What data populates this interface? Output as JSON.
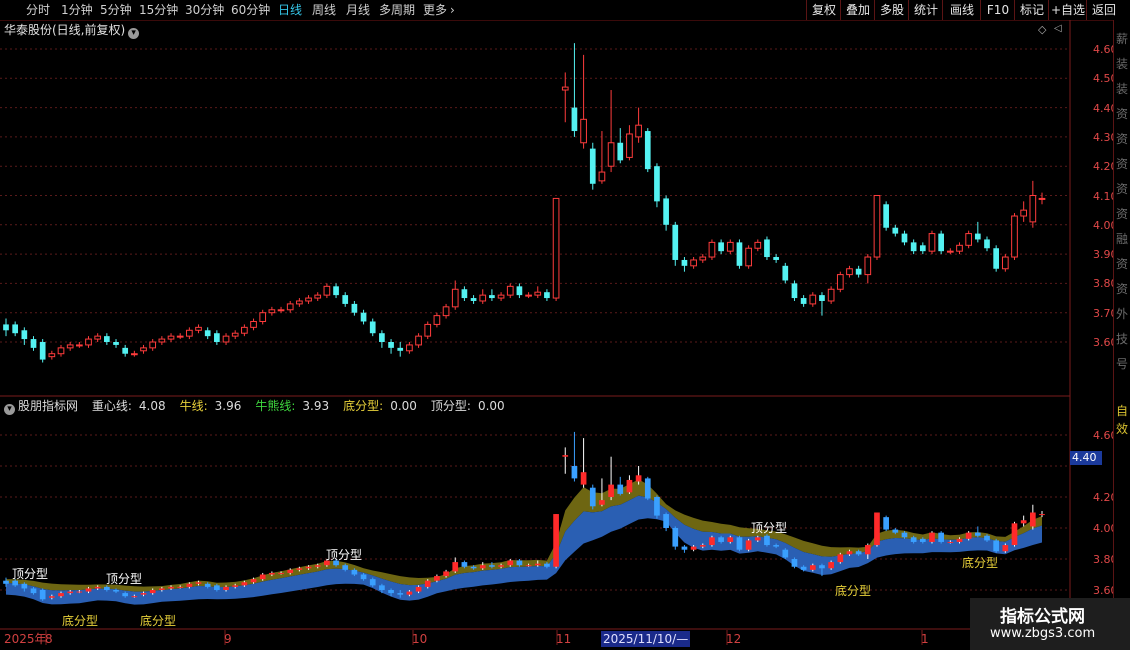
{
  "toolbar": {
    "periods": [
      "分时",
      "1分钟",
      "5分钟",
      "15分钟",
      "30分钟",
      "60分钟",
      "日线",
      "周线",
      "月线",
      "多周期",
      "更多"
    ],
    "active_period": "日线",
    "more_arrow": "›",
    "right_buttons": [
      "复权",
      "叠加",
      "多股",
      "统计",
      "画线",
      "F10",
      "标记",
      "+自选",
      "返回"
    ]
  },
  "main_chart": {
    "title": "华泰股份(日线,前复权)",
    "dropdown_icon": "chevron-down-icon",
    "price_axis": [
      "4.60",
      "4.50",
      "4.40",
      "4.30",
      "4.20",
      "4.10",
      "4.00",
      "3.90",
      "3.80",
      "3.70",
      "3.60"
    ]
  },
  "indicator": {
    "name": "股朋指标网",
    "fields": [
      {
        "label": "重心线:",
        "value": "4.08",
        "color": "#dcdcdc"
      },
      {
        "label": "牛线:",
        "value": "3.96",
        "color": "#e8d13a"
      },
      {
        "label": "牛熊线:",
        "value": "3.93",
        "color": "#3ed63e"
      },
      {
        "label": "底分型:",
        "value": "0.00",
        "color": "#e8d13a"
      },
      {
        "label": "顶分型:",
        "value": "0.00",
        "color": "#dcdcdc"
      }
    ],
    "price_axis": [
      "4.60",
      "4.40",
      "4.20",
      "4.00",
      "3.80",
      "3.60"
    ],
    "current_price": "4.40",
    "annotations": {
      "top": [
        "顶分型",
        "顶分型",
        "顶分型",
        "顶分型"
      ],
      "bottom": [
        "底分型",
        "底分型",
        "底分型",
        "底分型"
      ]
    }
  },
  "date_axis": {
    "labels": [
      "2025年",
      "8",
      "9",
      "10",
      "11",
      "2025/11/10/—",
      "12",
      "1"
    ]
  },
  "sidebar_chars": [
    "薪",
    "装",
    "装",
    "资",
    "资",
    "资",
    "资",
    "资",
    "融",
    "资",
    "资",
    "外",
    "技",
    "号"
  ],
  "sidebar_chars2": [
    "自",
    "效"
  ],
  "watermark": {
    "line1": "指标公式网",
    "line2": "www.zbgs3.com"
  },
  "colors": {
    "up": "#ff3c3c",
    "down": "#54f2f2",
    "gold": "#6e6612",
    "blue": "#2a5fb3",
    "axis": "#e04848"
  },
  "chart_data": {
    "type": "candlestick",
    "title": "华泰股份(日线,前复权)",
    "y_range": [
      3.52,
      4.65
    ],
    "x_labels": [
      "2025年",
      "8",
      "9",
      "10",
      "11",
      "12",
      "1"
    ],
    "candles": [
      {
        "o": 3.66,
        "c": 3.64,
        "h": 3.68,
        "l": 3.62
      },
      {
        "o": 3.66,
        "c": 3.63,
        "h": 3.67,
        "l": 3.62
      },
      {
        "o": 3.64,
        "c": 3.61,
        "h": 3.65,
        "l": 3.59
      },
      {
        "o": 3.61,
        "c": 3.58,
        "h": 3.62,
        "l": 3.57
      },
      {
        "o": 3.6,
        "c": 3.54,
        "h": 3.61,
        "l": 3.53
      },
      {
        "o": 3.55,
        "c": 3.56,
        "h": 3.57,
        "l": 3.54
      },
      {
        "o": 3.56,
        "c": 3.58,
        "h": 3.59,
        "l": 3.55
      },
      {
        "o": 3.58,
        "c": 3.59,
        "h": 3.6,
        "l": 3.57
      },
      {
        "o": 3.59,
        "c": 3.59,
        "h": 3.6,
        "l": 3.58
      },
      {
        "o": 3.59,
        "c": 3.61,
        "h": 3.62,
        "l": 3.58
      },
      {
        "o": 3.61,
        "c": 3.62,
        "h": 3.63,
        "l": 3.6
      },
      {
        "o": 3.62,
        "c": 3.6,
        "h": 3.63,
        "l": 3.59
      },
      {
        "o": 3.6,
        "c": 3.59,
        "h": 3.61,
        "l": 3.58
      },
      {
        "o": 3.58,
        "c": 3.56,
        "h": 3.59,
        "l": 3.55
      },
      {
        "o": 3.56,
        "c": 3.56,
        "h": 3.57,
        "l": 3.55
      },
      {
        "o": 3.57,
        "c": 3.58,
        "h": 3.59,
        "l": 3.56
      },
      {
        "o": 3.58,
        "c": 3.6,
        "h": 3.61,
        "l": 3.57
      },
      {
        "o": 3.6,
        "c": 3.61,
        "h": 3.62,
        "l": 3.59
      },
      {
        "o": 3.61,
        "c": 3.62,
        "h": 3.63,
        "l": 3.6
      },
      {
        "o": 3.62,
        "c": 3.62,
        "h": 3.63,
        "l": 3.61
      },
      {
        "o": 3.62,
        "c": 3.64,
        "h": 3.65,
        "l": 3.61
      },
      {
        "o": 3.64,
        "c": 3.65,
        "h": 3.66,
        "l": 3.63
      },
      {
        "o": 3.64,
        "c": 3.62,
        "h": 3.65,
        "l": 3.61
      },
      {
        "o": 3.63,
        "c": 3.6,
        "h": 3.64,
        "l": 3.59
      },
      {
        "o": 3.6,
        "c": 3.62,
        "h": 3.63,
        "l": 3.59
      },
      {
        "o": 3.62,
        "c": 3.63,
        "h": 3.64,
        "l": 3.61
      },
      {
        "o": 3.63,
        "c": 3.65,
        "h": 3.66,
        "l": 3.62
      },
      {
        "o": 3.65,
        "c": 3.67,
        "h": 3.68,
        "l": 3.64
      },
      {
        "o": 3.67,
        "c": 3.7,
        "h": 3.71,
        "l": 3.66
      },
      {
        "o": 3.7,
        "c": 3.71,
        "h": 3.72,
        "l": 3.69
      },
      {
        "o": 3.71,
        "c": 3.71,
        "h": 3.72,
        "l": 3.7
      },
      {
        "o": 3.71,
        "c": 3.73,
        "h": 3.74,
        "l": 3.7
      },
      {
        "o": 3.73,
        "c": 3.74,
        "h": 3.75,
        "l": 3.72
      },
      {
        "o": 3.74,
        "c": 3.75,
        "h": 3.76,
        "l": 3.73
      },
      {
        "o": 3.75,
        "c": 3.76,
        "h": 3.77,
        "l": 3.74
      },
      {
        "o": 3.76,
        "c": 3.79,
        "h": 3.8,
        "l": 3.75
      },
      {
        "o": 3.79,
        "c": 3.76,
        "h": 3.8,
        "l": 3.75
      },
      {
        "o": 3.76,
        "c": 3.73,
        "h": 3.77,
        "l": 3.72
      },
      {
        "o": 3.73,
        "c": 3.7,
        "h": 3.74,
        "l": 3.69
      },
      {
        "o": 3.7,
        "c": 3.67,
        "h": 3.71,
        "l": 3.66
      },
      {
        "o": 3.67,
        "c": 3.63,
        "h": 3.68,
        "l": 3.62
      },
      {
        "o": 3.63,
        "c": 3.6,
        "h": 3.64,
        "l": 3.58
      },
      {
        "o": 3.6,
        "c": 3.58,
        "h": 3.61,
        "l": 3.56
      },
      {
        "o": 3.58,
        "c": 3.57,
        "h": 3.6,
        "l": 3.55
      },
      {
        "o": 3.57,
        "c": 3.59,
        "h": 3.6,
        "l": 3.56
      },
      {
        "o": 3.59,
        "c": 3.62,
        "h": 3.63,
        "l": 3.58
      },
      {
        "o": 3.62,
        "c": 3.66,
        "h": 3.67,
        "l": 3.61
      },
      {
        "o": 3.66,
        "c": 3.69,
        "h": 3.7,
        "l": 3.65
      },
      {
        "o": 3.69,
        "c": 3.72,
        "h": 3.73,
        "l": 3.68
      },
      {
        "o": 3.72,
        "c": 3.78,
        "h": 3.81,
        "l": 3.71
      },
      {
        "o": 3.78,
        "c": 3.75,
        "h": 3.79,
        "l": 3.74
      },
      {
        "o": 3.75,
        "c": 3.74,
        "h": 3.76,
        "l": 3.73
      },
      {
        "o": 3.74,
        "c": 3.76,
        "h": 3.78,
        "l": 3.73
      },
      {
        "o": 3.76,
        "c": 3.75,
        "h": 3.78,
        "l": 3.74
      },
      {
        "o": 3.75,
        "c": 3.76,
        "h": 3.77,
        "l": 3.74
      },
      {
        "o": 3.76,
        "c": 3.79,
        "h": 3.8,
        "l": 3.75
      },
      {
        "o": 3.79,
        "c": 3.76,
        "h": 3.8,
        "l": 3.75
      },
      {
        "o": 3.76,
        "c": 3.76,
        "h": 3.77,
        "l": 3.75
      },
      {
        "o": 3.76,
        "c": 3.77,
        "h": 3.79,
        "l": 3.75
      },
      {
        "o": 3.77,
        "c": 3.75,
        "h": 3.78,
        "l": 3.74
      },
      {
        "o": 3.75,
        "c": 4.09,
        "h": 4.09,
        "l": 3.74
      },
      {
        "o": 4.46,
        "c": 4.47,
        "h": 4.52,
        "l": 4.35
      },
      {
        "o": 4.4,
        "c": 4.32,
        "h": 4.62,
        "l": 4.3
      },
      {
        "o": 4.28,
        "c": 4.36,
        "h": 4.58,
        "l": 4.26
      },
      {
        "o": 4.26,
        "c": 4.14,
        "h": 4.28,
        "l": 4.12
      },
      {
        "o": 4.15,
        "c": 4.18,
        "h": 4.32,
        "l": 4.14
      },
      {
        "o": 4.2,
        "c": 4.28,
        "h": 4.46,
        "l": 4.18
      },
      {
        "o": 4.28,
        "c": 4.22,
        "h": 4.33,
        "l": 4.21
      },
      {
        "o": 4.23,
        "c": 4.31,
        "h": 4.34,
        "l": 4.22
      },
      {
        "o": 4.3,
        "c": 4.34,
        "h": 4.4,
        "l": 4.28
      },
      {
        "o": 4.32,
        "c": 4.19,
        "h": 4.33,
        "l": 4.18
      },
      {
        "o": 4.2,
        "c": 4.08,
        "h": 4.21,
        "l": 4.06
      },
      {
        "o": 4.09,
        "c": 4.0,
        "h": 4.1,
        "l": 3.98
      },
      {
        "o": 4.0,
        "c": 3.88,
        "h": 4.01,
        "l": 3.86
      },
      {
        "o": 3.88,
        "c": 3.86,
        "h": 3.89,
        "l": 3.84
      },
      {
        "o": 3.86,
        "c": 3.88,
        "h": 3.89,
        "l": 3.85
      },
      {
        "o": 3.88,
        "c": 3.89,
        "h": 3.9,
        "l": 3.87
      },
      {
        "o": 3.89,
        "c": 3.94,
        "h": 3.95,
        "l": 3.88
      },
      {
        "o": 3.94,
        "c": 3.91,
        "h": 3.95,
        "l": 3.9
      },
      {
        "o": 3.91,
        "c": 3.94,
        "h": 3.95,
        "l": 3.9
      },
      {
        "o": 3.94,
        "c": 3.86,
        "h": 3.95,
        "l": 3.85
      },
      {
        "o": 3.86,
        "c": 3.92,
        "h": 3.93,
        "l": 3.85
      },
      {
        "o": 3.92,
        "c": 3.94,
        "h": 3.95,
        "l": 3.91
      },
      {
        "o": 3.95,
        "c": 3.89,
        "h": 3.96,
        "l": 3.88
      },
      {
        "o": 3.89,
        "c": 3.88,
        "h": 3.9,
        "l": 3.87
      },
      {
        "o": 3.86,
        "c": 3.81,
        "h": 3.87,
        "l": 3.8
      },
      {
        "o": 3.8,
        "c": 3.75,
        "h": 3.81,
        "l": 3.74
      },
      {
        "o": 3.75,
        "c": 3.73,
        "h": 3.76,
        "l": 3.72
      },
      {
        "o": 3.73,
        "c": 3.76,
        "h": 3.77,
        "l": 3.72
      },
      {
        "o": 3.76,
        "c": 3.74,
        "h": 3.77,
        "l": 3.69
      },
      {
        "o": 3.74,
        "c": 3.78,
        "h": 3.79,
        "l": 3.73
      },
      {
        "o": 3.78,
        "c": 3.83,
        "h": 3.84,
        "l": 3.77
      },
      {
        "o": 3.83,
        "c": 3.85,
        "h": 3.86,
        "l": 3.82
      },
      {
        "o": 3.85,
        "c": 3.83,
        "h": 3.86,
        "l": 3.82
      },
      {
        "o": 3.83,
        "c": 3.89,
        "h": 3.9,
        "l": 3.8
      },
      {
        "o": 3.89,
        "c": 4.1,
        "h": 4.1,
        "l": 3.88
      },
      {
        "o": 4.07,
        "c": 3.99,
        "h": 4.08,
        "l": 3.98
      },
      {
        "o": 3.99,
        "c": 3.97,
        "h": 4.0,
        "l": 3.96
      },
      {
        "o": 3.97,
        "c": 3.94,
        "h": 3.98,
        "l": 3.93
      },
      {
        "o": 3.94,
        "c": 3.91,
        "h": 3.95,
        "l": 3.9
      },
      {
        "o": 3.93,
        "c": 3.91,
        "h": 3.94,
        "l": 3.9
      },
      {
        "o": 3.91,
        "c": 3.97,
        "h": 3.98,
        "l": 3.9
      },
      {
        "o": 3.97,
        "c": 3.91,
        "h": 3.98,
        "l": 3.9
      },
      {
        "o": 3.91,
        "c": 3.91,
        "h": 3.92,
        "l": 3.9
      },
      {
        "o": 3.91,
        "c": 3.93,
        "h": 3.94,
        "l": 3.9
      },
      {
        "o": 3.93,
        "c": 3.97,
        "h": 3.98,
        "l": 3.92
      },
      {
        "o": 3.97,
        "c": 3.95,
        "h": 4.01,
        "l": 3.94
      },
      {
        "o": 3.95,
        "c": 3.92,
        "h": 3.96,
        "l": 3.91
      },
      {
        "o": 3.92,
        "c": 3.85,
        "h": 3.93,
        "l": 3.84
      },
      {
        "o": 3.85,
        "c": 3.89,
        "h": 3.9,
        "l": 3.84
      },
      {
        "o": 3.89,
        "c": 4.03,
        "h": 4.04,
        "l": 3.88
      },
      {
        "o": 4.03,
        "c": 4.05,
        "h": 4.08,
        "l": 4.01
      },
      {
        "o": 4.01,
        "c": 4.1,
        "h": 4.15,
        "l": 3.99
      },
      {
        "o": 4.09,
        "c": 4.09,
        "h": 4.11,
        "l": 4.07
      }
    ]
  }
}
